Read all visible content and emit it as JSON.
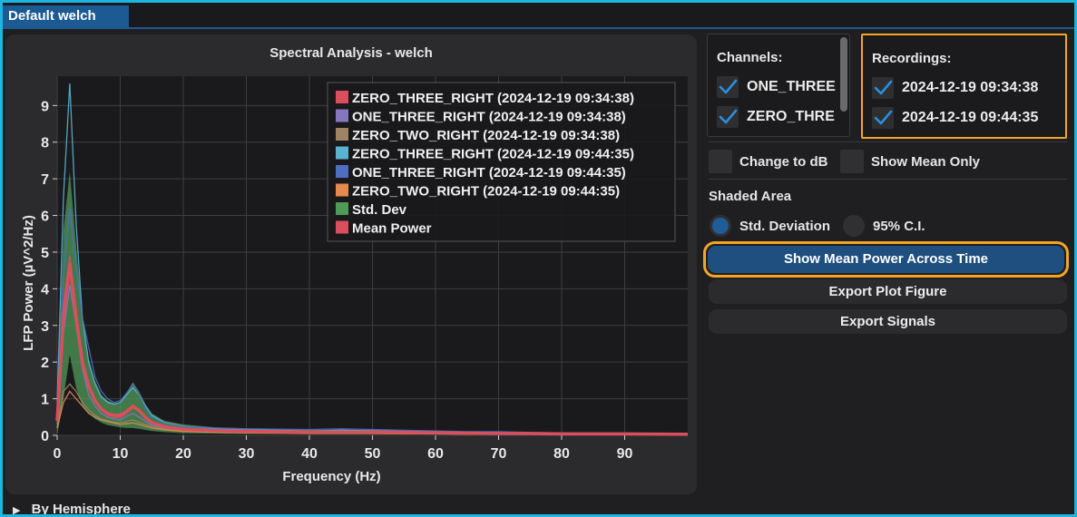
{
  "tab": {
    "label": "Default welch"
  },
  "chart_data": {
    "type": "line",
    "title": "Spectral Analysis - welch",
    "xlabel": "Frequency (Hz)",
    "ylabel": "LFP Power (µV^2/Hz)",
    "xlim": [
      0,
      100
    ],
    "ylim": [
      0,
      9.8
    ],
    "xticks": [
      0,
      10,
      20,
      30,
      40,
      50,
      60,
      70,
      80,
      90
    ],
    "yticks": [
      0,
      1,
      2,
      3,
      4,
      5,
      6,
      7,
      8,
      9
    ],
    "grid": true,
    "legend_position": "top-right",
    "legend": [
      {
        "label": "ZERO_THREE_RIGHT (2024-12-19 09:34:38)",
        "color": "#d94f5c"
      },
      {
        "label": "ONE_THREE_RIGHT (2024-12-19 09:34:38)",
        "color": "#8676c0"
      },
      {
        "label": "ZERO_TWO_RIGHT (2024-12-19 09:34:38)",
        "color": "#a08264"
      },
      {
        "label": "ZERO_THREE_RIGHT (2024-12-19 09:44:35)",
        "color": "#5cb3d1"
      },
      {
        "label": "ONE_THREE_RIGHT (2024-12-19 09:44:35)",
        "color": "#4e6fbf"
      },
      {
        "label": "ZERO_TWO_RIGHT (2024-12-19 09:44:35)",
        "color": "#e38a4c"
      },
      {
        "label": "Std. Dev",
        "color": "#4f9a57"
      },
      {
        "label": "Mean Power",
        "color": "#d94f5c"
      }
    ],
    "x": [
      0,
      1,
      2,
      3,
      4,
      5,
      6,
      7,
      8,
      9,
      10,
      11,
      12,
      13,
      14,
      15,
      17,
      20,
      25,
      30,
      35,
      40,
      45,
      50,
      55,
      60,
      65,
      70,
      75,
      80,
      85,
      90,
      100
    ],
    "series": [
      {
        "name": "ZERO_THREE_RIGHT (2024-12-19 09:34:38)",
        "color": "#d94f5c",
        "values": [
          0.4,
          3.6,
          4.9,
          3.5,
          2.1,
          1.3,
          0.9,
          0.7,
          0.55,
          0.5,
          0.48,
          0.6,
          0.75,
          0.65,
          0.45,
          0.32,
          0.22,
          0.15,
          0.11,
          0.09,
          0.08,
          0.07,
          0.07,
          0.07,
          0.06,
          0.05,
          0.05,
          0.04,
          0.03,
          0.03,
          0.03,
          0.03,
          0.03
        ]
      },
      {
        "name": "ONE_THREE_RIGHT (2024-12-19 09:34:38)",
        "color": "#8676c0",
        "values": [
          0.3,
          2.8,
          4.1,
          3.0,
          1.8,
          1.1,
          0.8,
          0.6,
          0.5,
          0.45,
          0.42,
          0.52,
          0.6,
          0.5,
          0.38,
          0.28,
          0.2,
          0.14,
          0.1,
          0.08,
          0.07,
          0.06,
          0.06,
          0.06,
          0.05,
          0.05,
          0.04,
          0.04,
          0.03,
          0.03,
          0.03,
          0.02,
          0.02
        ]
      },
      {
        "name": "ZERO_TWO_RIGHT (2024-12-19 09:34:38)",
        "color": "#a08264",
        "values": [
          0.2,
          1.2,
          1.4,
          1.2,
          0.9,
          0.7,
          0.55,
          0.45,
          0.4,
          0.36,
          0.34,
          0.38,
          0.42,
          0.36,
          0.3,
          0.24,
          0.18,
          0.13,
          0.1,
          0.08,
          0.07,
          0.06,
          0.06,
          0.05,
          0.05,
          0.04,
          0.04,
          0.03,
          0.03,
          0.03,
          0.02,
          0.02,
          0.02
        ]
      },
      {
        "name": "ZERO_THREE_RIGHT (2024-12-19 09:44:35)",
        "color": "#5cb3d1",
        "values": [
          0.9,
          6.5,
          9.6,
          5.8,
          3.2,
          2.0,
          1.4,
          1.05,
          0.9,
          0.85,
          0.9,
          1.1,
          1.3,
          1.1,
          0.8,
          0.55,
          0.35,
          0.25,
          0.18,
          0.15,
          0.14,
          0.12,
          0.14,
          0.13,
          0.11,
          0.1,
          0.09,
          0.08,
          0.07,
          0.06,
          0.06,
          0.05,
          0.05
        ]
      },
      {
        "name": "ONE_THREE_RIGHT (2024-12-19 09:44:35)",
        "color": "#4e6fbf",
        "values": [
          0.5,
          4.4,
          6.2,
          4.6,
          3.2,
          2.4,
          1.6,
          1.2,
          1.0,
          0.9,
          0.95,
          1.15,
          1.4,
          1.1,
          0.75,
          0.5,
          0.33,
          0.24,
          0.2,
          0.18,
          0.17,
          0.16,
          0.18,
          0.16,
          0.14,
          0.12,
          0.1,
          0.1,
          0.08,
          0.07,
          0.06,
          0.06,
          0.05
        ]
      },
      {
        "name": "ZERO_TWO_RIGHT (2024-12-19 09:44:35)",
        "color": "#e38a4c",
        "values": [
          0.2,
          0.9,
          1.2,
          1.0,
          0.8,
          0.6,
          0.5,
          0.42,
          0.38,
          0.34,
          0.3,
          0.32,
          0.34,
          0.3,
          0.25,
          0.2,
          0.15,
          0.11,
          0.08,
          0.07,
          0.06,
          0.05,
          0.05,
          0.05,
          0.04,
          0.04,
          0.03,
          0.03,
          0.03,
          0.02,
          0.02,
          0.02,
          0.02
        ]
      },
      {
        "name": "Mean Power",
        "color": "#d94f5c",
        "values": [
          0.4,
          3.2,
          4.7,
          3.2,
          2.0,
          1.35,
          0.95,
          0.72,
          0.6,
          0.55,
          0.55,
          0.65,
          0.8,
          0.68,
          0.49,
          0.35,
          0.24,
          0.17,
          0.13,
          0.11,
          0.1,
          0.09,
          0.09,
          0.09,
          0.08,
          0.07,
          0.06,
          0.05,
          0.05,
          0.04,
          0.04,
          0.04,
          0.03
        ]
      }
    ],
    "std_band": {
      "name": "Std. Dev",
      "color": "#4f9a57",
      "upper": [
        0.8,
        5.6,
        7.2,
        5.2,
        3.3,
        2.1,
        1.5,
        1.1,
        0.95,
        0.88,
        0.9,
        1.15,
        1.45,
        1.2,
        0.85,
        0.6,
        0.4,
        0.3,
        0.22,
        0.19,
        0.17,
        0.15,
        0.16,
        0.15,
        0.13,
        0.12,
        0.1,
        0.09,
        0.08,
        0.07,
        0.07,
        0.06,
        0.05
      ],
      "lower": [
        0.0,
        1.0,
        2.2,
        1.3,
        0.8,
        0.6,
        0.45,
        0.35,
        0.28,
        0.25,
        0.22,
        0.2,
        0.2,
        0.18,
        0.15,
        0.12,
        0.09,
        0.06,
        0.05,
        0.04,
        0.04,
        0.03,
        0.03,
        0.03,
        0.03,
        0.02,
        0.02,
        0.02,
        0.02,
        0.01,
        0.01,
        0.01,
        0.01
      ]
    }
  },
  "channels": {
    "title": "Channels:",
    "items": [
      {
        "label": "ONE_THREE",
        "checked": true
      },
      {
        "label": "ZERO_THRE",
        "checked": true
      }
    ]
  },
  "recordings": {
    "title": "Recordings:",
    "items": [
      {
        "label": "2024-12-19 09:34:38",
        "checked": true
      },
      {
        "label": "2024-12-19 09:44:35",
        "checked": true
      }
    ]
  },
  "options": {
    "db_label": "Change to dB",
    "mean_only_label": "Show Mean Only"
  },
  "shaded_area": {
    "title": "Shaded Area",
    "std_label": "Std. Deviation",
    "ci_label": "95% C.I.",
    "selected": "Std. Deviation"
  },
  "buttons": {
    "mean_power_time": "Show Mean Power Across Time",
    "export_plot": "Export Plot Figure",
    "export_signals": "Export Signals"
  },
  "hemisphere": {
    "label": "By Hemisphere",
    "arrow": "▶"
  },
  "colors": {
    "accent": "#1c5a93",
    "highlight": "#f2a626",
    "frame": "#1cb6e0"
  }
}
